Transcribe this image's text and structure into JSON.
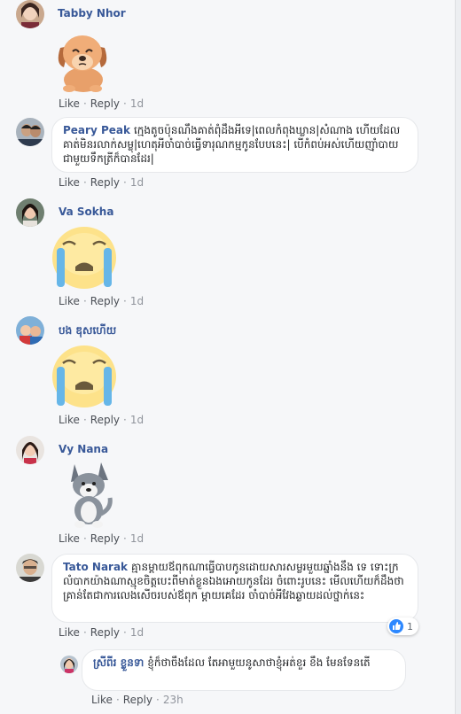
{
  "actions": {
    "like": "Like",
    "reply": "Reply",
    "separator": "·"
  },
  "comments": [
    {
      "author": "Tabby Nhor",
      "time": "1d",
      "sticker": "sad-puppy-sticker"
    },
    {
      "author": "Peary Peak",
      "time": "1d",
      "text": "ក្មេងតូចប៉ុនណឹងគាត់ពុំដឹងអីទេ|ពេលកំពុងឃ្លាន|សំណាង ហើយដែលគាត់មិនរលាក់សម្លុ|ហេតុអីចាំបាច់ធ្វើទារុណកម្មកូនបែបនេះ| បើកំពប់អស់ហើយញ៉ាំបាយជាមួយទឹកត្រីក៏បានដែរ|"
    },
    {
      "author": "Va Sokha",
      "time": "1d",
      "sticker": "crying-face-sticker"
    },
    {
      "author": "បង ឌុសហើយ",
      "time": "1d",
      "sticker": "crying-face-sticker"
    },
    {
      "author": "Vy Nana",
      "time": "1d",
      "sticker": "husky-dog-sticker"
    },
    {
      "author": "Tato Narak",
      "time": "1d",
      "text": "គ្មានម្តាយឪពុកណាធ្វើបាបកូនដោយសារសម្លរមួយឆ្នាំងនឹង ទេ ទោះក្រលំបាកយ៉ាងណាស្មុខចិត្តបេះពីមាត់ខ្លួនឯងអោយកូនដែរ ចំពោះរូបនេះ មើលហើយក៏ដឹងថាគ្រាន់តែជាការលេងសើចរបស់ឪពុក ម្តាយគេដែរ ចាំបាច់អីវែងឆ្ងាយដល់ថ្នាក់នេះ",
      "reaction_count": "1"
    }
  ],
  "reply": {
    "author": "ស្រីពីរ ខ្លួនទា",
    "text": "ខ្ញុំក៏ថាចឹងដែល តែអាមួយនូសាថាខ្ញុំអត់ខួរ ខឹង មែនទែនតើ",
    "time": "23h"
  }
}
